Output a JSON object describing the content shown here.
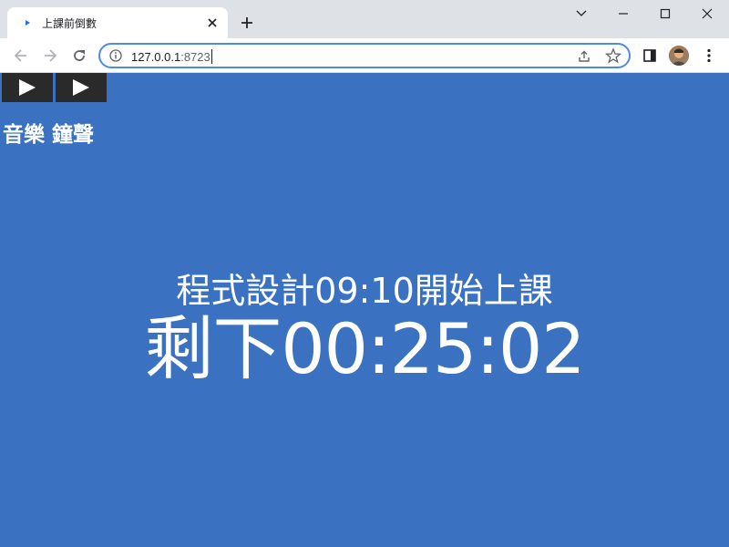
{
  "browser": {
    "tab": {
      "title": "上課前倒數"
    },
    "address_bar": {
      "host": "127.0.0.1",
      "port": ":8723"
    }
  },
  "page": {
    "media_controls": [
      {
        "label": "音樂"
      },
      {
        "label": "鐘聲"
      }
    ],
    "subtitle": "程式設計09:10開始上課",
    "countdown": "剩下00:25:02"
  },
  "colors": {
    "page_background": "#3a72c1",
    "text": "#ffffff",
    "tab_strip": "#dee1e6",
    "omnibox_focus": "#4d8ae6"
  }
}
